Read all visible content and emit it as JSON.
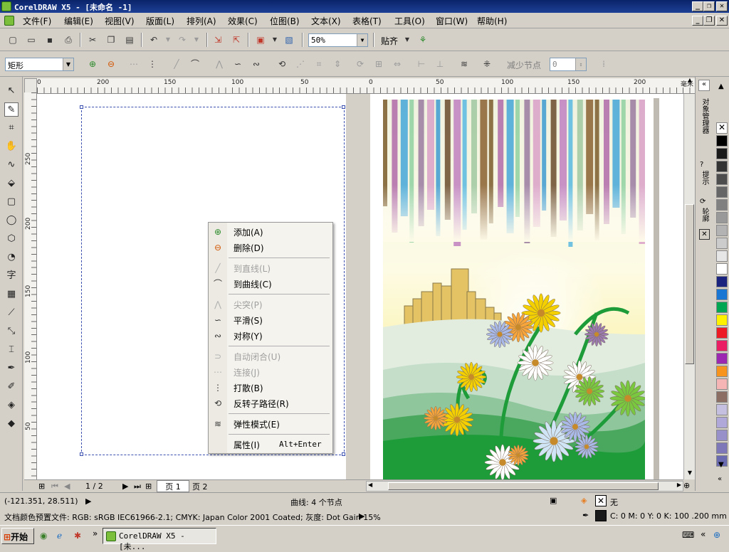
{
  "window": {
    "title": "CorelDRAW X5 - [未命名 -1]"
  },
  "menu": [
    "文件(F)",
    "编辑(E)",
    "视图(V)",
    "版面(L)",
    "排列(A)",
    "效果(C)",
    "位图(B)",
    "文本(X)",
    "表格(T)",
    "工具(O)",
    "窗口(W)",
    "帮助(H)"
  ],
  "toolbar": {
    "zoom": "50%",
    "snap_label": "贴齐"
  },
  "propbar": {
    "object_type": "矩形",
    "reduce_nodes_label": "减少节点",
    "reduce_nodes_value": "0"
  },
  "ruler": {
    "unit": "毫米",
    "top_labels": [
      "200",
      "150",
      "100",
      "50",
      "0",
      "50",
      "100",
      "150",
      "200"
    ],
    "left_labels": [
      "250",
      "200",
      "150",
      "100",
      "50"
    ]
  },
  "context_menu": {
    "items": [
      {
        "label": "添加(A)",
        "icon": "add-node-icon",
        "enabled": true
      },
      {
        "label": "删除(D)",
        "icon": "delete-node-icon",
        "enabled": true
      },
      {
        "label": "到直线(L)",
        "icon": "to-line-icon",
        "enabled": false
      },
      {
        "label": "到曲线(C)",
        "icon": "to-curve-icon",
        "enabled": true
      },
      {
        "label": "尖突(P)",
        "icon": "cusp-icon",
        "enabled": false
      },
      {
        "label": "平滑(S)",
        "icon": "smooth-icon",
        "enabled": true
      },
      {
        "label": "对称(Y)",
        "icon": "symmetric-icon",
        "enabled": true
      },
      {
        "label": "自动闭合(U)",
        "icon": "auto-close-icon",
        "enabled": false
      },
      {
        "label": "连接(J)",
        "icon": "join-icon",
        "enabled": false
      },
      {
        "label": "打散(B)",
        "icon": "break-icon",
        "enabled": true
      },
      {
        "label": "反转子路径(R)",
        "icon": "reverse-subpath-icon",
        "enabled": true
      },
      {
        "label": "弹性模式(E)",
        "icon": "elastic-mode-icon",
        "enabled": true
      },
      {
        "label": "属性(I)",
        "icon": "properties-icon",
        "enabled": true,
        "shortcut": "Alt+Enter"
      }
    ]
  },
  "pages": {
    "indicator": "1 / 2",
    "tabs": [
      "页 1",
      "页 2"
    ]
  },
  "docker": {
    "tabs": [
      "对象管理器",
      "提示",
      "轮廓"
    ]
  },
  "palette": [
    "#000000",
    "#1a1a1a",
    "#333333",
    "#4d4d4d",
    "#666666",
    "#808080",
    "#999999",
    "#b3b3b3",
    "#cccccc",
    "#e6e6e6",
    "#ffffff",
    "#1a237e",
    "#1976d2",
    "#00a651",
    "#fff200",
    "#ed1c24",
    "#e91e63",
    "#9c27b0",
    "#f7941d",
    "#f5b5b5",
    "#8d6e63",
    "#c5c0e0",
    "#b0a8d8",
    "#9890c8",
    "#7e78b8",
    "#6a6ab0"
  ],
  "status": {
    "coords": "(-121.351, 28.511)",
    "object_info": "曲线: 4 个节点",
    "color_profile": "文档颜色预置文件: RGB: sRGB IEC61966-2.1; CMYK: Japan Color 2001 Coated; 灰度: Dot Gain 15%",
    "fill_label": "无",
    "outline_info": "C: 0 M: 0 Y: 0 K: 100  .200 mm"
  },
  "taskbar": {
    "start_label": "开始",
    "task_label": "CorelDRAW X5 - [未..."
  }
}
